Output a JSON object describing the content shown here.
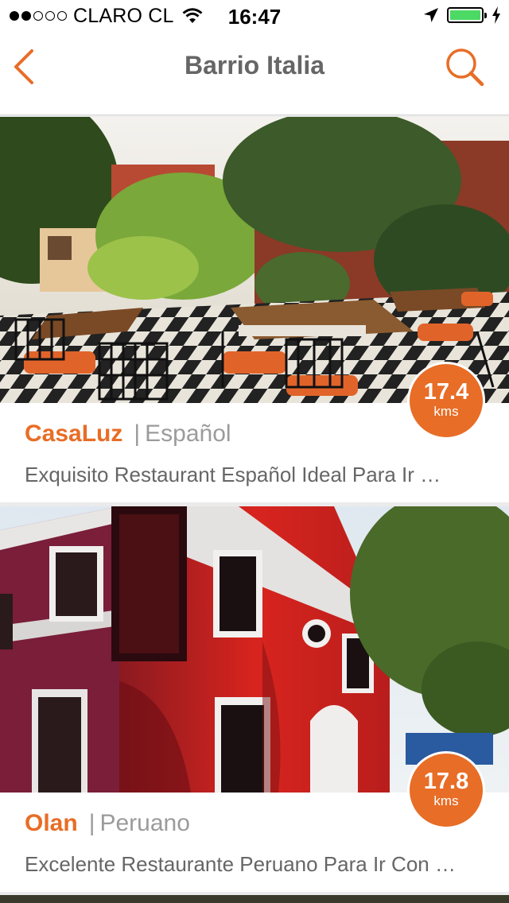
{
  "status_bar": {
    "carrier": "CLARO CL",
    "signal_bars": 2,
    "time": "16:47"
  },
  "nav": {
    "title": "Barrio Italia"
  },
  "restaurants": [
    {
      "name": "CasaLuz",
      "cuisine": "Español",
      "description": "Exquisito Restaurant Español Ideal Para Ir …",
      "distance": "17.4",
      "distance_unit": "kms"
    },
    {
      "name": "Olan",
      "cuisine": "Peruano",
      "description": "Excelente Restaurante Peruano Para Ir Con …",
      "distance": "17.8",
      "distance_unit": "kms"
    }
  ],
  "colors": {
    "accent": "#e86d26",
    "battery": "#4cd964"
  }
}
